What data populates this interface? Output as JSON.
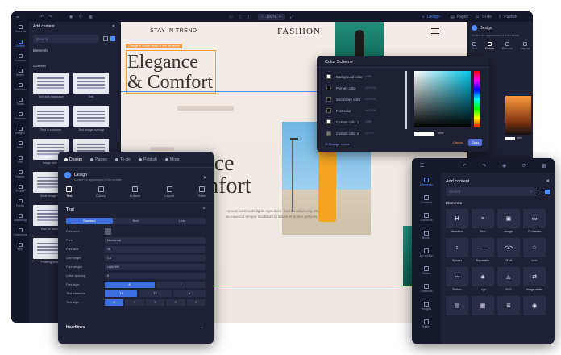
{
  "topbar": {
    "tabs": [
      {
        "label": "Design",
        "icon": "palette-icon",
        "active": true
      },
      {
        "label": "Pages",
        "icon": "pages-icon",
        "active": false
      },
      {
        "label": "To-do",
        "icon": "todo-icon",
        "active": false
      },
      {
        "label": "Publish",
        "icon": "publish-icon",
        "active": false
      }
    ],
    "zoom": "100%"
  },
  "left_sidebar": {
    "items": [
      {
        "label": "Elements",
        "icon": "grid-icon"
      },
      {
        "label": "Content",
        "icon": "content-icon"
      },
      {
        "label": "Columns",
        "icon": "columns-icon"
      },
      {
        "label": "Boxes",
        "icon": "boxes-icon"
      },
      {
        "label": "Accordion",
        "icon": "accordion-icon"
      },
      {
        "label": "Tables",
        "icon": "table-icon"
      },
      {
        "label": "Features",
        "icon": "features-icon"
      },
      {
        "label": "Images",
        "icon": "image-icon"
      },
      {
        "label": "Slider",
        "icon": "slider-icon"
      },
      {
        "label": "Text",
        "icon": "text-icon"
      },
      {
        "label": "Header",
        "icon": "header-icon"
      },
      {
        "label": "Footer",
        "icon": "footer-icon"
      },
      {
        "label": "Forms",
        "icon": "forms-icon"
      },
      {
        "label": "Marketing",
        "icon": "marketing-icon"
      },
      {
        "label": "Collections",
        "icon": "collections-icon"
      },
      {
        "label": "Shop",
        "icon": "shop-icon"
      }
    ],
    "active_index": 1
  },
  "add_content": {
    "title": "Add content",
    "search_placeholder": "Search",
    "section_elements": "Elements",
    "section_content": "Content",
    "templates": [
      "Text with separator",
      "Text",
      "Text in columns",
      "Text image overlap",
      "Image with t",
      "",
      "Wide image wit",
      "",
      "Text on backgr",
      "",
      "Floating image"
    ]
  },
  "website": {
    "tagline": "STAY IN TREND",
    "brand": "FASHION",
    "headline_line1": "Elegance",
    "headline_line2": "& Comfort",
    "selection_label": "Change to create corals to see the action",
    "headline2_line1": "Elegance",
    "headline2_line2": "& Comfort",
    "body_line1": "Aenean commodo ligula eget dolor. Sed tur adipiscing elit,",
    "body_line2": "do eiusmod tempor incididunt ut labore et dolore pictures"
  },
  "right_sidebar": {
    "title": "Design",
    "subtitle": "Control the appearance of the website",
    "tabs": [
      "Text",
      "Colors",
      "Buttons",
      "Layout"
    ],
    "active_tab": "Colors",
    "hex": "#ffffff"
  },
  "color_scheme": {
    "title": "Color Scheme",
    "rows": [
      {
        "name": "Background color",
        "hex": "#ffffff",
        "color": "#ffffff"
      },
      {
        "name": "Primary color",
        "hex": "#000000",
        "color": "#000000"
      },
      {
        "name": "Secondary color",
        "hex": "#000000",
        "color": "#000000"
      },
      {
        "name": "Font color",
        "hex": "#000000",
        "color": "#000000"
      },
      {
        "name": "Custom color 1",
        "hex": "#ffffff",
        "color": "#ffffff"
      },
      {
        "name": "Custom color 2",
        "hex": "#7f7f7f",
        "color": "#7f7f7f"
      }
    ],
    "change_link": "Change colors",
    "picker_hex": "#ffffff",
    "cancel_label": "Cancel",
    "okay_label": "Okay"
  },
  "design_panel": {
    "tabs": [
      {
        "label": "Design",
        "active": true
      },
      {
        "label": "Pages",
        "active": false
      },
      {
        "label": "To-do",
        "active": false
      },
      {
        "label": "Publish",
        "active": false
      },
      {
        "label": "More",
        "active": false
      }
    ],
    "title": "Design",
    "subtitle": "Control the appearance of the website",
    "inner_tabs": [
      {
        "label": "Text",
        "active": true
      },
      {
        "label": "Colors",
        "active": false
      },
      {
        "label": "Buttons",
        "active": false
      },
      {
        "label": "Layout",
        "active": false
      },
      {
        "label": "Sites",
        "active": false
      }
    ],
    "section_text": "Text",
    "segments": [
      "Standard",
      "Bold",
      "Links"
    ],
    "active_segment": "Standard",
    "props": [
      {
        "label": "Font color",
        "type": "swatch",
        "value": ""
      },
      {
        "label": "Font",
        "type": "input",
        "value": "Montserrat"
      },
      {
        "label": "Font size",
        "type": "input",
        "value": "16"
      },
      {
        "label": "Line height",
        "type": "input",
        "value": "1.8"
      },
      {
        "label": "Font weight",
        "type": "input",
        "value": "Light 300"
      },
      {
        "label": "Letter spacing",
        "type": "input",
        "value": "0"
      }
    ],
    "font_style": {
      "label": "Font style",
      "options": [
        "A",
        "I"
      ]
    },
    "text_transform": {
      "label": "Text transform",
      "options": [
        "Tt",
        "TT",
        "tt"
      ]
    },
    "text_align": {
      "label": "Text align",
      "options": [
        "⊘",
        "≡",
        "≡",
        "≡",
        "≡"
      ]
    },
    "section_headlines": "Headlines"
  },
  "mobile_add": {
    "title": "Add content",
    "search_placeholder": "Search",
    "elements_label": "Elements",
    "sidebar": [
      {
        "label": "Elements",
        "active": true
      },
      {
        "label": "Content",
        "active": false
      },
      {
        "label": "Columns",
        "active": false
      },
      {
        "label": "Boxes",
        "active": false
      },
      {
        "label": "Accordion",
        "active": false
      },
      {
        "label": "Tables",
        "active": false
      },
      {
        "label": "Features",
        "active": false
      },
      {
        "label": "Images",
        "active": false
      },
      {
        "label": "Slider",
        "active": false
      }
    ],
    "elements": [
      {
        "label": "Headline",
        "glyph": "H"
      },
      {
        "label": "Text",
        "glyph": "≡"
      },
      {
        "label": "Image",
        "glyph": "▣"
      },
      {
        "label": "Container",
        "glyph": "▭"
      },
      {
        "label": "Spacer",
        "glyph": "↕"
      },
      {
        "label": "Separator",
        "glyph": "—"
      },
      {
        "label": "HTML",
        "glyph": "</>"
      },
      {
        "label": "Icon",
        "glyph": "☆"
      },
      {
        "label": "Button",
        "glyph": "▭"
      },
      {
        "label": "Logo",
        "glyph": "◈"
      },
      {
        "label": "SVG",
        "glyph": "◬"
      },
      {
        "label": "Image slider",
        "glyph": "⇄"
      },
      {
        "label": "",
        "glyph": "▤"
      },
      {
        "label": "",
        "glyph": "▦"
      },
      {
        "label": "",
        "glyph": "≣"
      },
      {
        "label": "",
        "glyph": "◉"
      }
    ]
  }
}
